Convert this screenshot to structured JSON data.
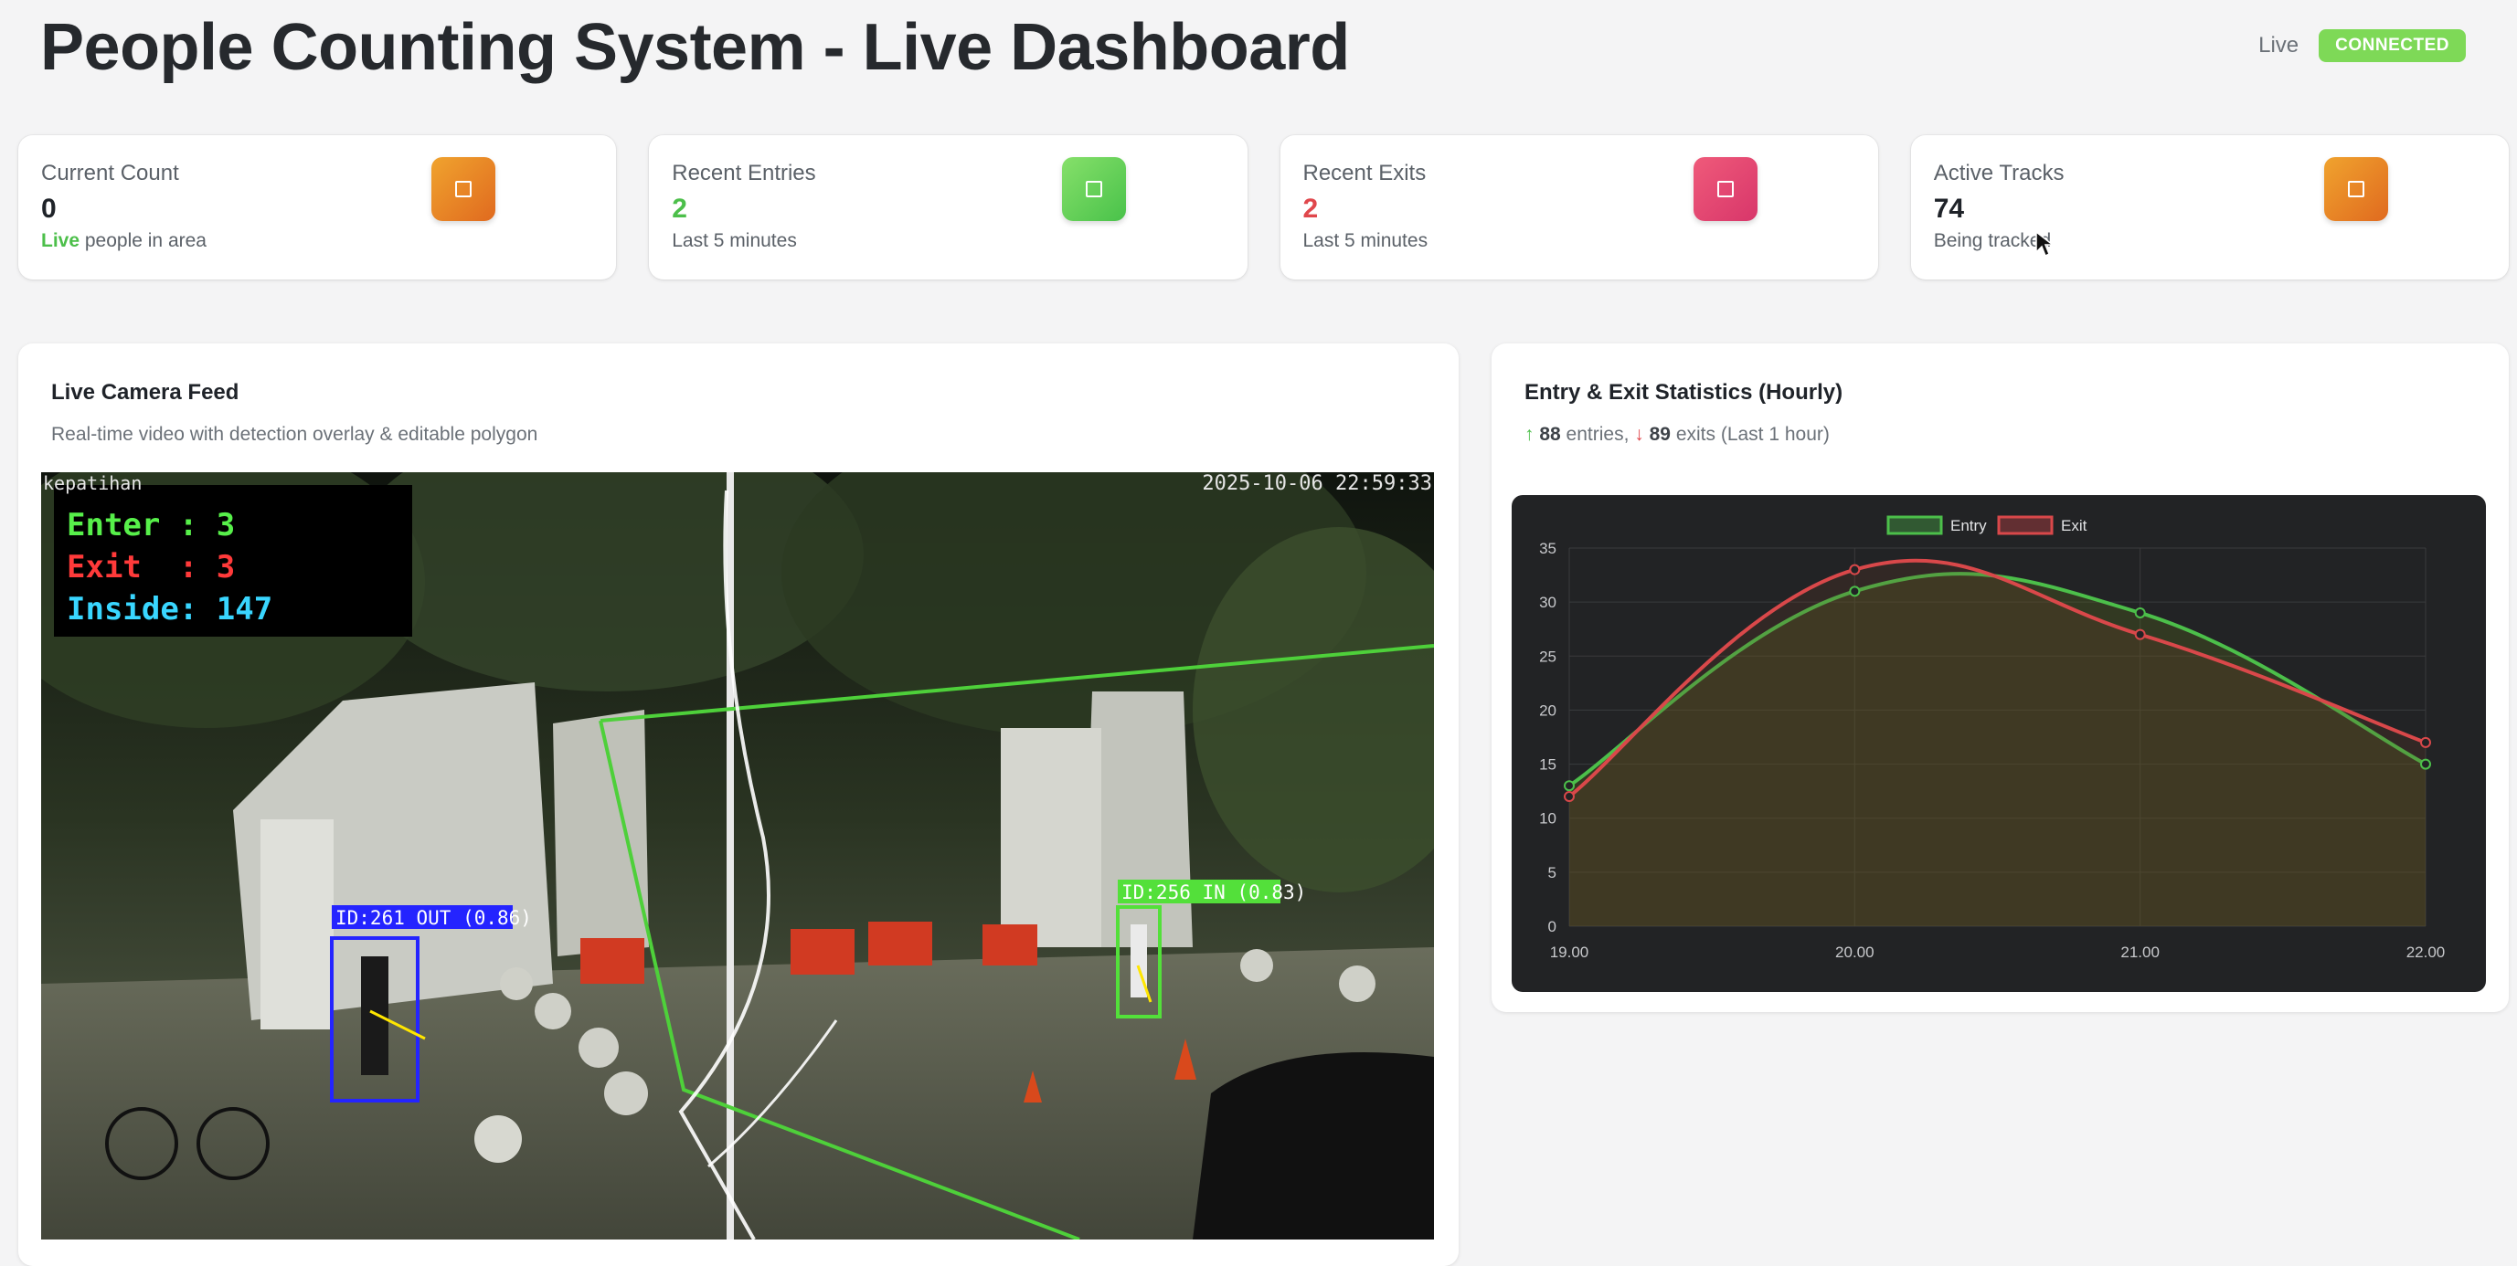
{
  "header": {
    "title": "People Counting System - Live Dashboard",
    "live_label": "Live",
    "status_badge": "CONNECTED"
  },
  "stats": [
    {
      "label": "Current Count",
      "value": "0",
      "sub_highlight": "Live",
      "sub": " people in area",
      "icon": "square-icon",
      "color": "#e88a25"
    },
    {
      "label": "Recent Entries",
      "value": "2",
      "sub": "Last 5 minutes",
      "icon": "square-icon",
      "color": "#5fcf55"
    },
    {
      "label": "Recent Exits",
      "value": "2",
      "sub": "Last 5 minutes",
      "icon": "square-icon",
      "color": "#e24670"
    },
    {
      "label": "Active Tracks",
      "value": "74",
      "sub": "Being tracked",
      "icon": "square-icon",
      "color": "#e88a25"
    }
  ],
  "camera": {
    "title": "Live Camera Feed",
    "subtitle": "Real-time video with detection overlay & editable polygon",
    "watermark": "kepatihan",
    "timestamp": "2025-10-06 22:59:33",
    "overlay": {
      "enter": "Enter : 3",
      "exit": "Exit  : 3",
      "inside": "Inside: 147"
    },
    "detections": [
      {
        "label": "ID:261 OUT (0.86)",
        "color": "#2424ff"
      },
      {
        "label": "ID:256 IN (0.83)",
        "color": "#53e03a"
      }
    ]
  },
  "stats_panel": {
    "title": "Entry & Exit Statistics (Hourly)",
    "entries_value": "88",
    "entries_text": "entries,",
    "exits_value": "89",
    "exits_text": "exits (Last 1 hour)"
  },
  "chart_data": {
    "type": "line",
    "x": [
      "19.00",
      "20.00",
      "21.00",
      "22.00"
    ],
    "series": [
      {
        "name": "Entry",
        "values": [
          13,
          31,
          29,
          15
        ],
        "color": "#4cbf4a"
      },
      {
        "name": "Exit",
        "values": [
          12,
          33,
          27,
          17
        ],
        "color": "#d9484a"
      }
    ],
    "ylim": [
      0,
      35
    ],
    "yticks": [
      0,
      5,
      10,
      15,
      20,
      25,
      30,
      35
    ],
    "grid": true,
    "legend": "top-center"
  }
}
